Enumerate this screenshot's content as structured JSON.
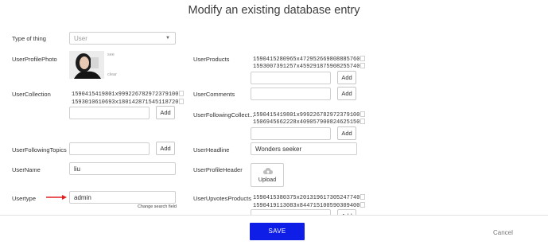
{
  "title": "Modify an existing database entry",
  "type_of_thing": {
    "label": "Type of thing",
    "value": "User"
  },
  "left": {
    "photo_label": "UserProfilePhoto",
    "photo_see": "see",
    "photo_clear": "clear",
    "collection_label": "UserCollection",
    "collection_items": [
      "1590415419801x999226782972379100",
      "1593010610693x180142871545118720"
    ],
    "following_topics_label": "UserFollowingTopics",
    "username_label": "UserName",
    "username_value": "liu",
    "usertype_label": "Usertype",
    "usertype_value": "admin",
    "change_search_field": "Change search field"
  },
  "right": {
    "products_label": "UserProducts",
    "products_items": [
      "1590415280965x472952669808885760",
      "1593007391257x459291875908255740"
    ],
    "comments_label": "UserComments",
    "following_collect_label": "UserFollowingCollect...",
    "following_collect_items": [
      "1590415419801x999226782972379100",
      "1506945662228x409057900824625150"
    ],
    "headline_label": "UserHeadline",
    "headline_value": "Wonders seeker",
    "profile_header_label": "UserProfileHeader",
    "upload_label": "Upload",
    "upvotes_label": "UserUpvotesProducts",
    "upvotes_items": [
      "1590415380375x201319617305247740",
      "1590419113083x844715100590309400"
    ]
  },
  "add_label": "Add",
  "footer": {
    "save": "SAVE",
    "cancel": "Cancel"
  },
  "colors": {
    "save_button": "#0e1ee6",
    "arrow": "#e02020"
  }
}
